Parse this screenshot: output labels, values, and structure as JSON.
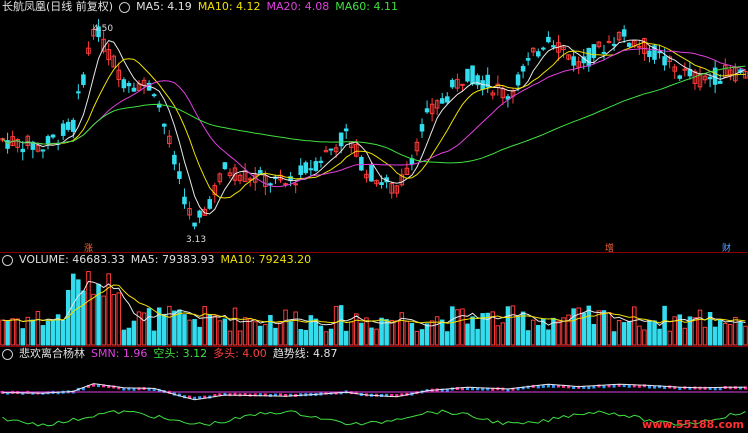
{
  "price_header": {
    "title": "长航凤凰(日线 前复权)",
    "ma5": "MA5: 4.19",
    "ma10": "MA10: 4.12",
    "ma20": "MA20: 4.08",
    "ma60": "MA60: 4.11"
  },
  "volume_header": {
    "volume": "VOLUME: 46683.33",
    "ma5": "MA5: 79383.93",
    "ma10": "MA10: 79243.20"
  },
  "indicator_header": {
    "name": "悲欢离合杨林",
    "smn": "SMN: 1.96",
    "kong": "空头: 3.12",
    "duo": "多头: 4.00",
    "trend": "趋势线: 4.87"
  },
  "annotations": {
    "high": "4.50",
    "low": "3.13",
    "marker_zhang": "涨",
    "marker_zeng": "增",
    "marker_cai": "财"
  },
  "watermark": "www.55188.com",
  "colors": {
    "up": "#ff3b3b",
    "down": "#33ddee",
    "ma5": "#e8e8e8",
    "ma10": "#f0e000",
    "ma20": "#e040e0",
    "ma60": "#40e040"
  }
}
